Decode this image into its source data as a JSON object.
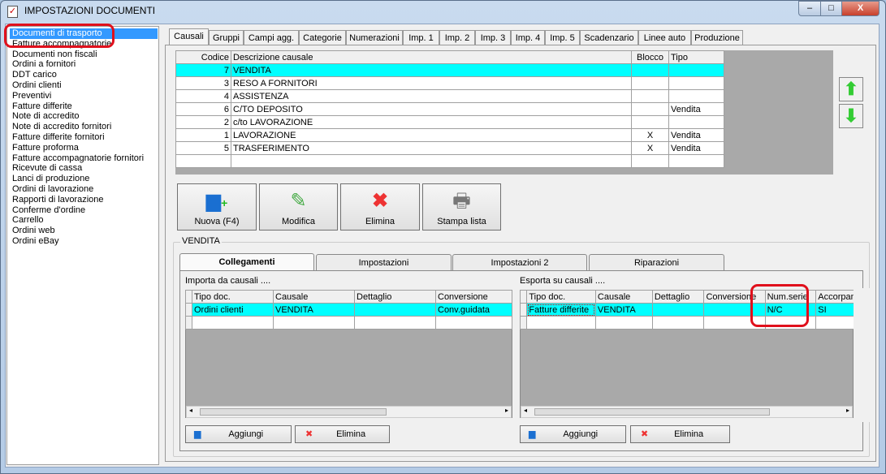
{
  "window": {
    "title": "IMPOSTAZIONI DOCUMENTI",
    "min": "–",
    "max": "□",
    "close": "X"
  },
  "doc_types": [
    "Documenti di trasporto",
    "Fatture accompagnatorie",
    "Documenti non fiscali",
    "Ordini a fornitori",
    "DDT carico",
    "Ordini clienti",
    "Preventivi",
    "Fatture differite",
    "Note di accredito",
    "Note di accredito fornitori",
    "Fatture differite fornitori",
    "Fatture proforma",
    "Fatture accompagnatorie fornitori",
    "Ricevute di cassa",
    "Lanci di produzione",
    "Ordini di lavorazione",
    "Rapporti di lavorazione",
    "Conferme d'ordine",
    "Carrello",
    "Ordini web",
    "Ordini eBay"
  ],
  "tabs": [
    "Causali",
    "Gruppi",
    "Campi agg.",
    "Categorie",
    "Numerazioni",
    "Imp. 1",
    "Imp. 2",
    "Imp. 3",
    "Imp. 4",
    "Imp. 5",
    "Scadenzario",
    "Linee auto",
    "Produzione"
  ],
  "causali": {
    "headers": [
      "Codice",
      "Descrizione causale",
      "Blocco",
      "Tipo"
    ],
    "rows": [
      [
        "7",
        "VENDITA",
        "",
        ""
      ],
      [
        "3",
        "RESO A FORNITORI",
        "",
        ""
      ],
      [
        "4",
        "ASSISTENZA",
        "",
        ""
      ],
      [
        "6",
        "C/TO DEPOSITO",
        "",
        "Vendita"
      ],
      [
        "2",
        "c/to LAVORAZIONE",
        "",
        ""
      ],
      [
        "1",
        "LAVORAZIONE",
        "X",
        "Vendita"
      ],
      [
        "5",
        "TRASFERIMENTO",
        "X",
        "Vendita"
      ],
      [
        "",
        "",
        "",
        ""
      ]
    ]
  },
  "toolbar": {
    "new": "Nuova (F4)",
    "edit": "Modifica",
    "delete": "Elimina",
    "print": "Stampa lista"
  },
  "group_label": "VENDITA",
  "subtabs": [
    "Collegamenti",
    "Impostazioni",
    "Impostazioni 2",
    "Riparazioni"
  ],
  "importa": {
    "label": "Importa da causali ....",
    "headers": [
      "Tipo doc.",
      "Causale",
      "Dettaglio",
      "Conversione"
    ],
    "rows": [
      [
        "Ordini clienti",
        "VENDITA",
        "",
        "Conv.guidata"
      ],
      [
        "",
        "",
        "",
        ""
      ]
    ],
    "add": "Aggiungi",
    "delete": "Elimina"
  },
  "esporta": {
    "label": "Esporta su causali ....",
    "headers": [
      "Tipo doc.",
      "Causale",
      "Dettaglio",
      "Conversione",
      "Num.serie",
      "Accorpamen"
    ],
    "rows": [
      [
        "Fatture differite",
        "VENDITA",
        "",
        "",
        "N/C",
        "SI"
      ],
      [
        "",
        "",
        "",
        "",
        "",
        ""
      ]
    ],
    "add": "Aggiungi",
    "delete": "Elimina"
  }
}
